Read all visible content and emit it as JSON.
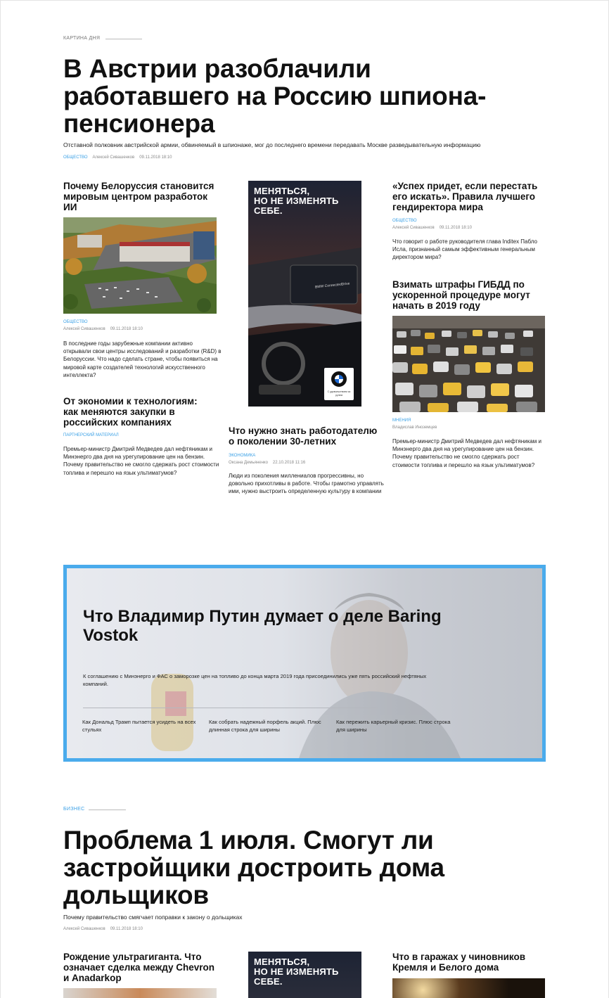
{
  "top": {
    "section_label": "КАРТИНА ДНЯ",
    "headline": "В Австрии разоблачили работавшего на Россию шпиона-пенсионера",
    "lead": "Отставной полковник австрийской армии, обвиняемый в шпионаже, мог до последнего времени передавать Москве разведывательную информацию",
    "rubric": "ОБЩЕСТВО",
    "author": "Алексей Сивашенков",
    "date": "09.11.2018 18:10"
  },
  "col1": {
    "card1": {
      "title": "Почему Белоруссия становится мировым центром разработок ИИ",
      "rubric": "ОБЩЕСТВО",
      "author": "Алексей Сивашенков",
      "date": "09.11.2018 18:10",
      "text": "В последние годы зарубежные компании активно открывали свои центры исследований и разработки (R&D) в Белоруссии. Что надо сделать стране, чтобы появиться на мировой карте создателей технологий искусственного интеллекта?"
    },
    "card2": {
      "title": "От экономии к технологиям: как меняются закупки в российских компаниях",
      "rubric": "ПАРТНЕРСКИЙ МАТЕРИАЛ",
      "text": "Премьер-министр Дмитрий Медведев дал нефтяникам и Минэнерго два дня на урегулирование цен на бензин. Почему правительство не смогло сдержать рост стоимости топлива и перешло на язык ультиматумов?"
    }
  },
  "col2": {
    "ad": {
      "headline": "МЕНЯТЬСЯ,\nНО НЕ ИЗМЕНЯТЬ\nСЕБЕ.",
      "dash_label": "BMW ConnectedDrive",
      "badge_text": "С удовольствием за рулем"
    },
    "card": {
      "title": "Что нужно знать работодателю о поколении 30-летних",
      "rubric": "ЭКОНОМИКА",
      "author": "Оксана Демьяненко",
      "date": "22.10.2018 11:16",
      "text": "Люди из поколения миллениалов прогрессивны, но довольно прихотливы в работе. Чтобы грамотно управлять ими, нужно выстроить определенную культуру в компании"
    }
  },
  "col3": {
    "card1": {
      "title": "«Успех придет, если перестать его искать». Правила лучшего гендиректора мира",
      "rubric": "ОБЩЕСТВО",
      "author": "Алексей Сивашенков",
      "date": "09.11.2018 18:10",
      "text": "Что говорит о работе руководителя глава Inditex Пабло Исла, признанный самым эффективным генеральным директором мира?"
    },
    "card2": {
      "title": "Взимать штрафы ГИБДД по ускоренной процедуре могут начать в 2019 году",
      "rubric": "МНЕНИЯ",
      "author": "Владислав Иноземцев",
      "text": "Премьер-министр Дмитрий Медведев дал нефтяникам и Минэнерго два дня на урегулирование цен на бензин. Почему правительство не смогло сдержать рост стоимости топлива и перешло на язык ультиматумов?"
    }
  },
  "banner": {
    "title": "Что Владимир Путин думает о деле Baring Vostok",
    "lead": "К соглашению с Минэнерго и ФАС о заморозке цен на топливо до конца марта 2019 года присоединились уже пять российский нефтяных компаний.",
    "links": [
      "Как Дональд Трамп пытается усидеть на всех стульях",
      "Как собрать надежный порфель акций. Плюс длинная строка для ширины",
      "Как пережить карьерный кризис. Плюс строка для ширины"
    ]
  },
  "business": {
    "section_label": "БИЗНЕС",
    "headline": "Проблема 1 июля. Смогут ли застройщики достроить дома дольщиков",
    "lead": "Почему правительство смягчает поправки к закону о дольщиках",
    "author": "Алексей Сивашенков",
    "date": "09.11.2018 18:10"
  },
  "bottom": {
    "card1_title": "Рождение ультрагиганта. Что означает сделка между Chevron и Anadarkop",
    "ad_headline": "МЕНЯТЬСЯ,\nНО НЕ ИЗМЕНЯТЬ\nСЕБЕ.",
    "card3_title": "Что в гаражах у чиновников Кремля и Белого дома"
  },
  "colors": {
    "accent": "#3aa0e6",
    "banner_border": "#4aabec"
  }
}
